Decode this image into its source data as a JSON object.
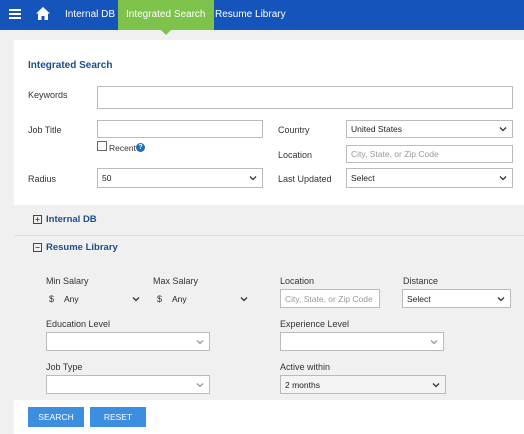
{
  "nav": {
    "tabs": [
      {
        "label": "Internal DB"
      },
      {
        "label": "Integrated Search"
      },
      {
        "label": "Resume Library"
      }
    ],
    "active_tab": "Integrated Search",
    "colors": {
      "bar": "#1554bb",
      "active": "#7dc24a"
    }
  },
  "search": {
    "title": "Integrated Search",
    "keywords": {
      "label": "Keywords",
      "value": ""
    },
    "job_title": {
      "label": "Job Title",
      "value": ""
    },
    "recent": {
      "label": "Recent",
      "checked": false
    },
    "radius": {
      "label": "Radius",
      "value": "50"
    },
    "country": {
      "label": "Country",
      "value": "United States"
    },
    "location": {
      "label": "Location",
      "placeholder": "City, State, or Zip Code"
    },
    "last_updated": {
      "label": "Last Updated",
      "value": "Select"
    }
  },
  "sections": {
    "internal_db": {
      "label": "Internal DB",
      "expanded": false
    },
    "resume_library": {
      "label": "Resume Library",
      "expanded": true
    }
  },
  "resume_library": {
    "min_salary": {
      "label": "Min Salary",
      "currency": "$",
      "value": "Any"
    },
    "max_salary": {
      "label": "Max Salary",
      "currency": "$",
      "value": "Any"
    },
    "location": {
      "label": "Location",
      "placeholder": "City, State, or Zip Code"
    },
    "distance": {
      "label": "Distance",
      "value": "Select"
    },
    "education_level": {
      "label": "Education Level",
      "value": ""
    },
    "experience_level": {
      "label": "Experience Level",
      "value": ""
    },
    "job_type": {
      "label": "Job Type",
      "value": ""
    },
    "active_within": {
      "label": "Active within",
      "value": "2 months"
    }
  },
  "buttons": {
    "search": "SEARCH",
    "reset": "RESET",
    "color": "#3c8ee0"
  }
}
